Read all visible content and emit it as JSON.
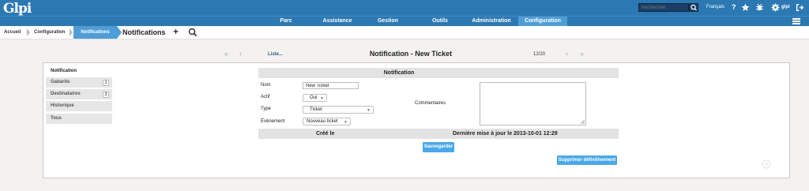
{
  "header": {
    "logo": "Glpi",
    "search_placeholder": "Rechercher",
    "language": "Français",
    "help_icon": "?",
    "user": "glpi"
  },
  "menu": {
    "items": [
      {
        "label": "Parc"
      },
      {
        "label": "Assistance"
      },
      {
        "label": "Gestion"
      },
      {
        "label": "Outils"
      },
      {
        "label": "Administration"
      },
      {
        "label": "Configuration"
      }
    ],
    "active": "Configuration"
  },
  "breadcrumb": {
    "items": [
      "Accueil",
      "Configuration",
      "Notifications"
    ],
    "page_title": "Notifications"
  },
  "navigation": {
    "list_link": "Liste...",
    "title": "Notification - New Ticket",
    "counter": "12/20"
  },
  "tabs": [
    {
      "label": "Notification"
    },
    {
      "label": "Gabarits",
      "count": "1"
    },
    {
      "label": "Destinataires",
      "count": "2"
    },
    {
      "label": "Historique"
    },
    {
      "label": "Tous"
    }
  ],
  "form": {
    "header": "Notification",
    "name_label": "Nom",
    "name_value": "New Ticket",
    "active_label": "Actif",
    "active_value": "Oui",
    "type_label": "Type",
    "type_value": "Ticket",
    "event_label": "Évènement",
    "event_value": "Nouveau ticket",
    "comments_label": "Commentaires",
    "created_label": "Créé le",
    "updated_label": "Dernière mise à jour le 2013-10-01 12:29",
    "save_button": "Sauvegarder",
    "delete_button": "Supprimer définitivement"
  },
  "colors": {
    "header_bg": "#2c78b2",
    "menu_active": "#4f9dd6",
    "button": "#4aa8e8"
  }
}
